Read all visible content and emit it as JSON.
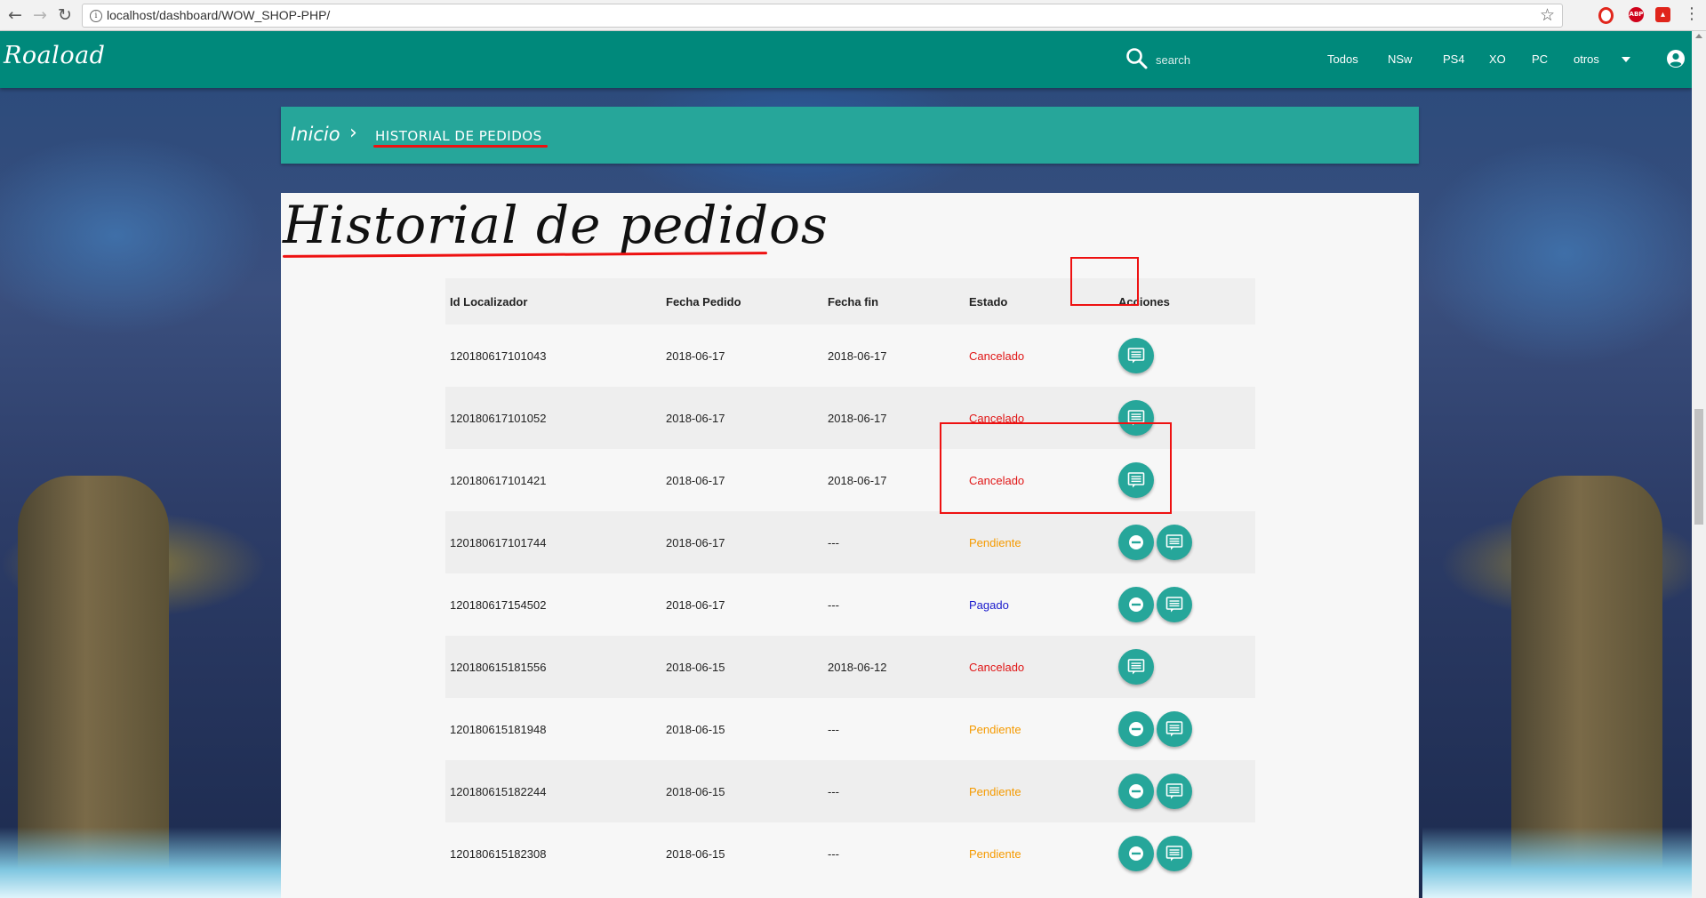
{
  "browser": {
    "url": "localhost/dashboard/WOW_SHOP-PHP/"
  },
  "navbar": {
    "brand": "Roaload",
    "search_placeholder": "search",
    "links": [
      "Todos",
      "NSw",
      "PS4",
      "XO",
      "PC",
      "otros"
    ],
    "color": "#00897b"
  },
  "breadcrumb": {
    "home": "Inicio",
    "separator": "›",
    "current": "HISTORIAL DE PEDIDOS"
  },
  "page": {
    "title": "Historial de pedidos"
  },
  "table": {
    "headers": [
      "Id Localizador",
      "Fecha Pedido",
      "Fecha fin",
      "Estado",
      "Acciones"
    ],
    "rows": [
      {
        "id": "120180617101043",
        "fecha_pedido": "2018-06-17",
        "fecha_fin": "2018-06-17",
        "estado": "Cancelado",
        "cancel_action": false
      },
      {
        "id": "120180617101052",
        "fecha_pedido": "2018-06-17",
        "fecha_fin": "2018-06-17",
        "estado": "Cancelado",
        "cancel_action": false
      },
      {
        "id": "120180617101421",
        "fecha_pedido": "2018-06-17",
        "fecha_fin": "2018-06-17",
        "estado": "Cancelado",
        "cancel_action": false
      },
      {
        "id": "120180617101744",
        "fecha_pedido": "2018-06-17",
        "fecha_fin": "---",
        "estado": "Pendiente",
        "cancel_action": true
      },
      {
        "id": "120180617154502",
        "fecha_pedido": "2018-06-17",
        "fecha_fin": "---",
        "estado": "Pagado",
        "cancel_action": true
      },
      {
        "id": "120180615181556",
        "fecha_pedido": "2018-06-15",
        "fecha_fin": "2018-06-12",
        "estado": "Cancelado",
        "cancel_action": false
      },
      {
        "id": "120180615181948",
        "fecha_pedido": "2018-06-15",
        "fecha_fin": "---",
        "estado": "Pendiente",
        "cancel_action": true
      },
      {
        "id": "120180615182244",
        "fecha_pedido": "2018-06-15",
        "fecha_fin": "---",
        "estado": "Pendiente",
        "cancel_action": true
      },
      {
        "id": "120180615182308",
        "fecha_pedido": "2018-06-15",
        "fecha_fin": "---",
        "estado": "Pendiente",
        "cancel_action": true
      }
    ]
  },
  "status_colors": {
    "Cancelado": "#e01616",
    "Pendiente": "#f59a00",
    "Pagado": "#1a1acc"
  },
  "icons": {
    "details": "message-list-icon",
    "cancel": "minus-circle-icon"
  }
}
